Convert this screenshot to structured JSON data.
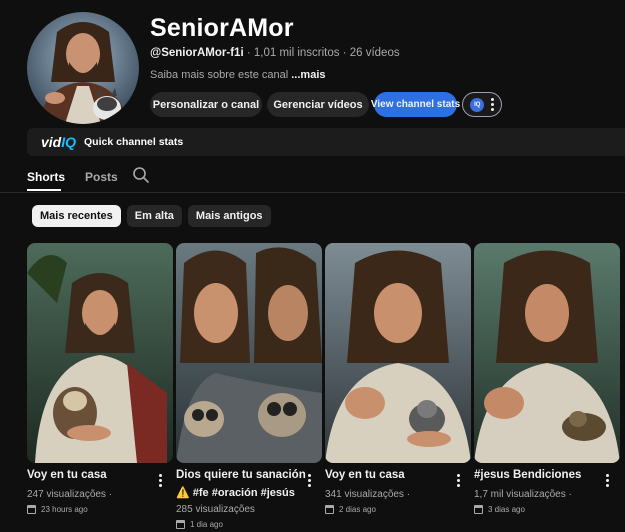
{
  "channel": {
    "name": "SeniorAMor",
    "handle": "@SeniorAMor-f1i",
    "subscribers": "· 1,01 mil inscritos · 26 vídeos",
    "about": "Saiba mais sobre este canal",
    "about_more": "...mais"
  },
  "buttons": {
    "customize": "Personalizar o canal",
    "manage": "Gerenciar vídeos",
    "channel_stats": "View channel stats",
    "vidiq_badge": "IQ"
  },
  "vidiq": {
    "logo_left": "vid",
    "logo_right": "IQ",
    "label": "Quick channel stats"
  },
  "tabs": [
    {
      "label": "Shorts"
    },
    {
      "label": "Posts"
    }
  ],
  "chips": [
    {
      "label": "Mais recentes"
    },
    {
      "label": "Em alta"
    },
    {
      "label": "Mais antigos"
    }
  ],
  "shorts": [
    {
      "title": "Voy en tu casa",
      "subtitle": "",
      "views": "247 visualizações ·",
      "date": "23 hours ago"
    },
    {
      "title": "Dios quiere tu sanación",
      "subtitle": "⚠️ #fe #oración #jesús",
      "views": "285 visualizações",
      "date": "1 dia ago"
    },
    {
      "title": "Voy en tu casa",
      "subtitle": "",
      "views": "341 visualizações ·",
      "date": "2 dias ago"
    },
    {
      "title": "#jesus Bendiciones",
      "subtitle": "",
      "views": "1,7 mil visualizações ·",
      "date": "3 dias ago"
    }
  ],
  "icons": {
    "search": "search-icon",
    "menu": "more-vert-icon",
    "calendar": "calendar-icon"
  }
}
